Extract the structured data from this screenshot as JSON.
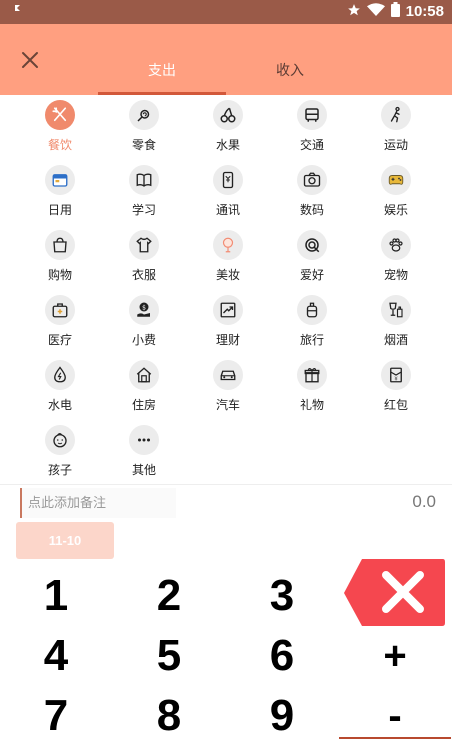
{
  "status_bar": {
    "time": "10:58",
    "icons": [
      "notification-icon",
      "star-icon",
      "wifi-icon",
      "battery-icon"
    ]
  },
  "header": {
    "close_icon": "close-icon",
    "tabs": [
      {
        "label": "支出",
        "active": true
      },
      {
        "label": "收入",
        "active": false
      }
    ]
  },
  "categories": [
    {
      "label": "餐饮",
      "icon": "utensils-icon",
      "active": true
    },
    {
      "label": "零食",
      "icon": "candy-icon"
    },
    {
      "label": "水果",
      "icon": "cherry-icon"
    },
    {
      "label": "交通",
      "icon": "bus-icon"
    },
    {
      "label": "运动",
      "icon": "running-icon"
    },
    {
      "label": "日用",
      "icon": "calendar-icon"
    },
    {
      "label": "学习",
      "icon": "book-icon"
    },
    {
      "label": "通讯",
      "icon": "phone-icon"
    },
    {
      "label": "数码",
      "icon": "camera-icon"
    },
    {
      "label": "娱乐",
      "icon": "gamepad-icon"
    },
    {
      "label": "购物",
      "icon": "shopping-bag-icon"
    },
    {
      "label": "衣服",
      "icon": "shirt-icon"
    },
    {
      "label": "美妆",
      "icon": "mirror-icon"
    },
    {
      "label": "爱好",
      "icon": "target-icon"
    },
    {
      "label": "宠物",
      "icon": "paw-icon"
    },
    {
      "label": "医疗",
      "icon": "medkit-icon"
    },
    {
      "label": "小费",
      "icon": "tip-icon"
    },
    {
      "label": "理财",
      "icon": "chart-up-icon"
    },
    {
      "label": "旅行",
      "icon": "luggage-icon"
    },
    {
      "label": "烟酒",
      "icon": "wine-icon"
    },
    {
      "label": "水电",
      "icon": "water-drop-icon"
    },
    {
      "label": "住房",
      "icon": "house-icon"
    },
    {
      "label": "汽车",
      "icon": "car-icon"
    },
    {
      "label": "礼物",
      "icon": "gift-icon"
    },
    {
      "label": "红包",
      "icon": "red-envelope-icon"
    },
    {
      "label": "孩子",
      "icon": "baby-icon"
    },
    {
      "label": "其他",
      "icon": "more-icon"
    }
  ],
  "input": {
    "remark_placeholder": "点此添加备注",
    "amount": "0.0"
  },
  "date": "11-10",
  "keypad": {
    "digits": [
      "1",
      "2",
      "3",
      "4",
      "5",
      "6",
      "7",
      "8",
      "9"
    ],
    "delete_icon": "delete-icon",
    "operators": [
      "+",
      "-"
    ]
  },
  "colors": {
    "status_bar": "#9a5a48",
    "header": "#ff9f80",
    "accent": "#f08a6c",
    "tab_underline": "#d2583a",
    "delete_key": "#f5474f",
    "date_button": "#fcd6ca"
  }
}
